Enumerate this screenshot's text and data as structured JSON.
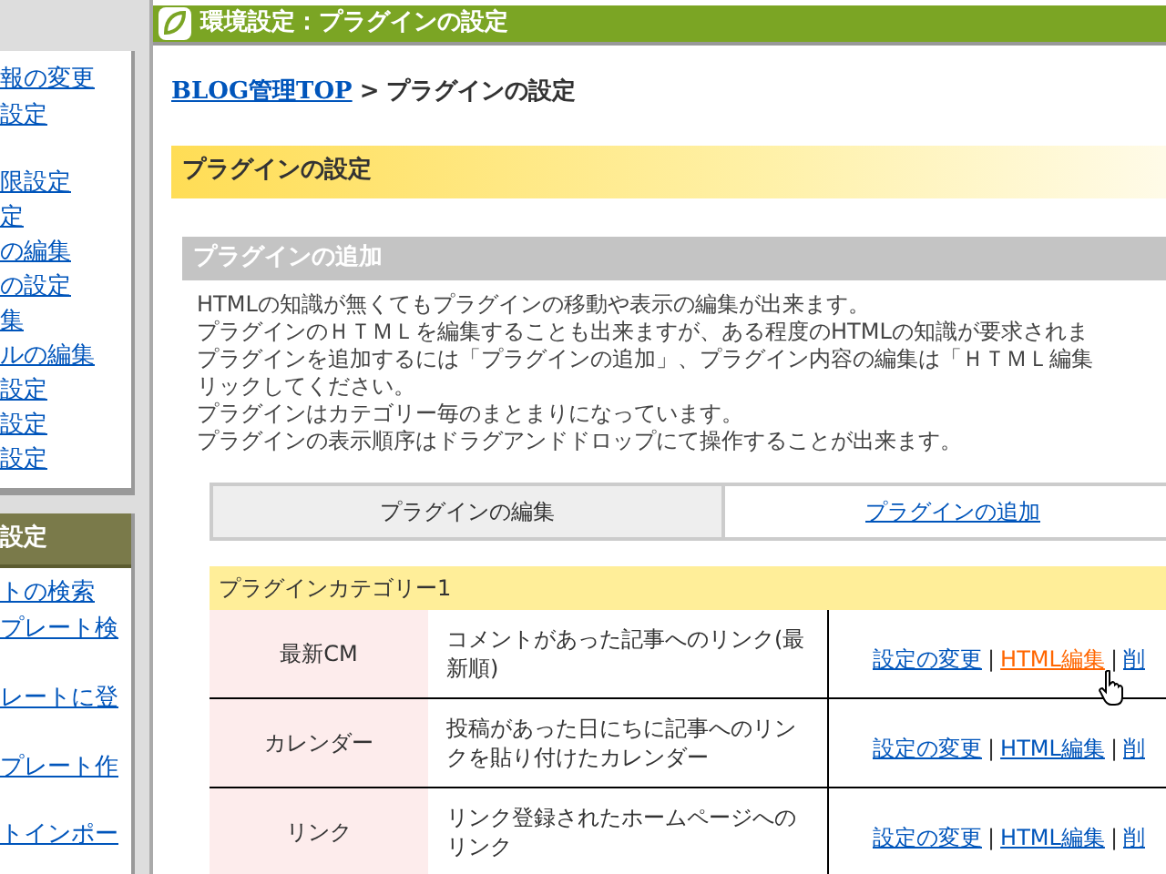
{
  "sidebar": {
    "sections": [
      {
        "items": [
          {
            "label": "報の変更",
            "kind": "single"
          },
          {
            "label": "設定",
            "kind": "tall"
          },
          {
            "label": "限設定",
            "kind": "single"
          },
          {
            "label": "定",
            "kind": "single"
          },
          {
            "label": "の編集",
            "kind": "single"
          },
          {
            "label": "の設定",
            "kind": "single"
          },
          {
            "label": "集",
            "kind": "single"
          },
          {
            "label": "ルの編集",
            "kind": "single"
          },
          {
            "label": "設定",
            "kind": "single"
          },
          {
            "label": "設定",
            "kind": "single"
          },
          {
            "label": "設定",
            "kind": "single"
          }
        ]
      },
      {
        "title": "設定",
        "items": [
          {
            "label": "トの検索",
            "kind": "single"
          },
          {
            "label": "プレート検",
            "kind": "tall"
          },
          {
            "label": "レートに登",
            "kind": "tall"
          },
          {
            "label": "プレート作",
            "kind": "tall"
          },
          {
            "label": "トインポー",
            "kind": "single"
          }
        ]
      }
    ]
  },
  "main": {
    "title": "環境設定：プラグインの設定",
    "breadcrumb": {
      "link": "BLOG管理TOP",
      "separator": ">",
      "current": "プラグインの設定"
    },
    "page_heading": "プラグインの設定",
    "section_heading": "プラグインの追加",
    "description": [
      "HTMLの知識が無くてもプラグインの移動や表示の編集が出来ます。",
      "プラグインのＨＴＭＬを編集することも出来ますが、ある程度のHTMLの知識が要求されま",
      "プラグインを追加するには「プラグインの追加」、プラグイン内容の編集は「ＨＴＭＬ編集",
      "リックしてください。",
      "プラグインはカテゴリー毎のまとまりになっています。",
      "プラグインの表示順序はドラグアンドドロップにて操作することが出来ます。"
    ],
    "tabs": [
      {
        "label": "プラグインの編集",
        "selected": true
      },
      {
        "label": "プラグインの追加",
        "selected": false
      }
    ],
    "category": {
      "title": "プラグインカテゴリー1",
      "separator": "|",
      "plugins": [
        {
          "name": "最新CM",
          "description": "コメントがあった記事へのリンク(最新順)",
          "actions": [
            {
              "label": "設定の変更",
              "hovered": false
            },
            {
              "label": "HTML編集",
              "hovered": true
            },
            {
              "label": "削",
              "hovered": false
            }
          ]
        },
        {
          "name": "カレンダー",
          "description": "投稿があった日にちに記事へのリンクを貼り付けたカレンダー",
          "actions": [
            {
              "label": "設定の変更",
              "hovered": false
            },
            {
              "label": "HTML編集",
              "hovered": false
            },
            {
              "label": "削",
              "hovered": false
            }
          ]
        },
        {
          "name": "リンク",
          "description": "リンク登録されたホームページへのリンク",
          "actions": [
            {
              "label": "設定の変更",
              "hovered": false
            },
            {
              "label": "HTML編集",
              "hovered": false
            },
            {
              "label": "削",
              "hovered": false
            }
          ]
        }
      ]
    }
  }
}
